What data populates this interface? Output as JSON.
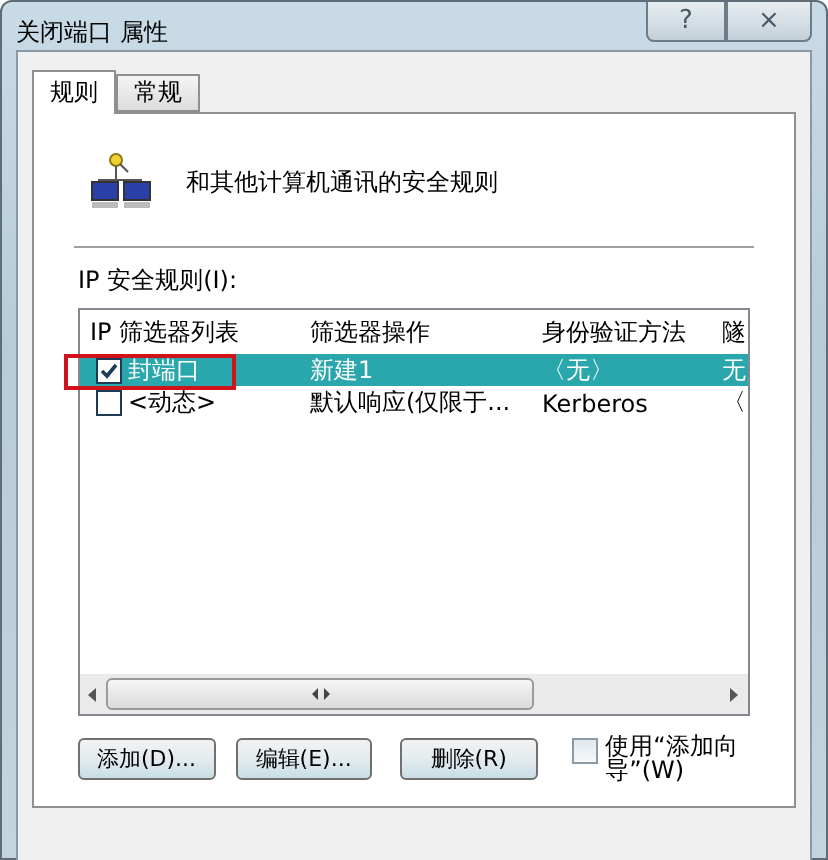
{
  "window": {
    "title": "关闭端口 属性",
    "help": "?",
    "close": "×"
  },
  "tabs": [
    {
      "label": "规则",
      "selected": true
    },
    {
      "label": "常规",
      "selected": false
    }
  ],
  "intro": "和其他计算机通讯的安全规则",
  "rules_label": "IP 安全规则(I):",
  "table": {
    "columns": [
      "IP 筛选器列表",
      "筛选器操作",
      "身份验证方法",
      "隧"
    ],
    "rows": [
      {
        "checked": true,
        "selected": true,
        "highlighted": true,
        "cells": [
          "封端口",
          "新建1",
          "〈无〉",
          "无"
        ]
      },
      {
        "checked": false,
        "selected": false,
        "highlighted": false,
        "cells": [
          "<动态>",
          "默认响应(仅限于...",
          "Kerberos",
          "〈"
        ]
      }
    ]
  },
  "buttons": [
    "添加(D)...",
    "编辑(E)...",
    "删除(R)"
  ],
  "wizard": {
    "label": "使用“添加向导”(W)",
    "checked": false
  }
}
